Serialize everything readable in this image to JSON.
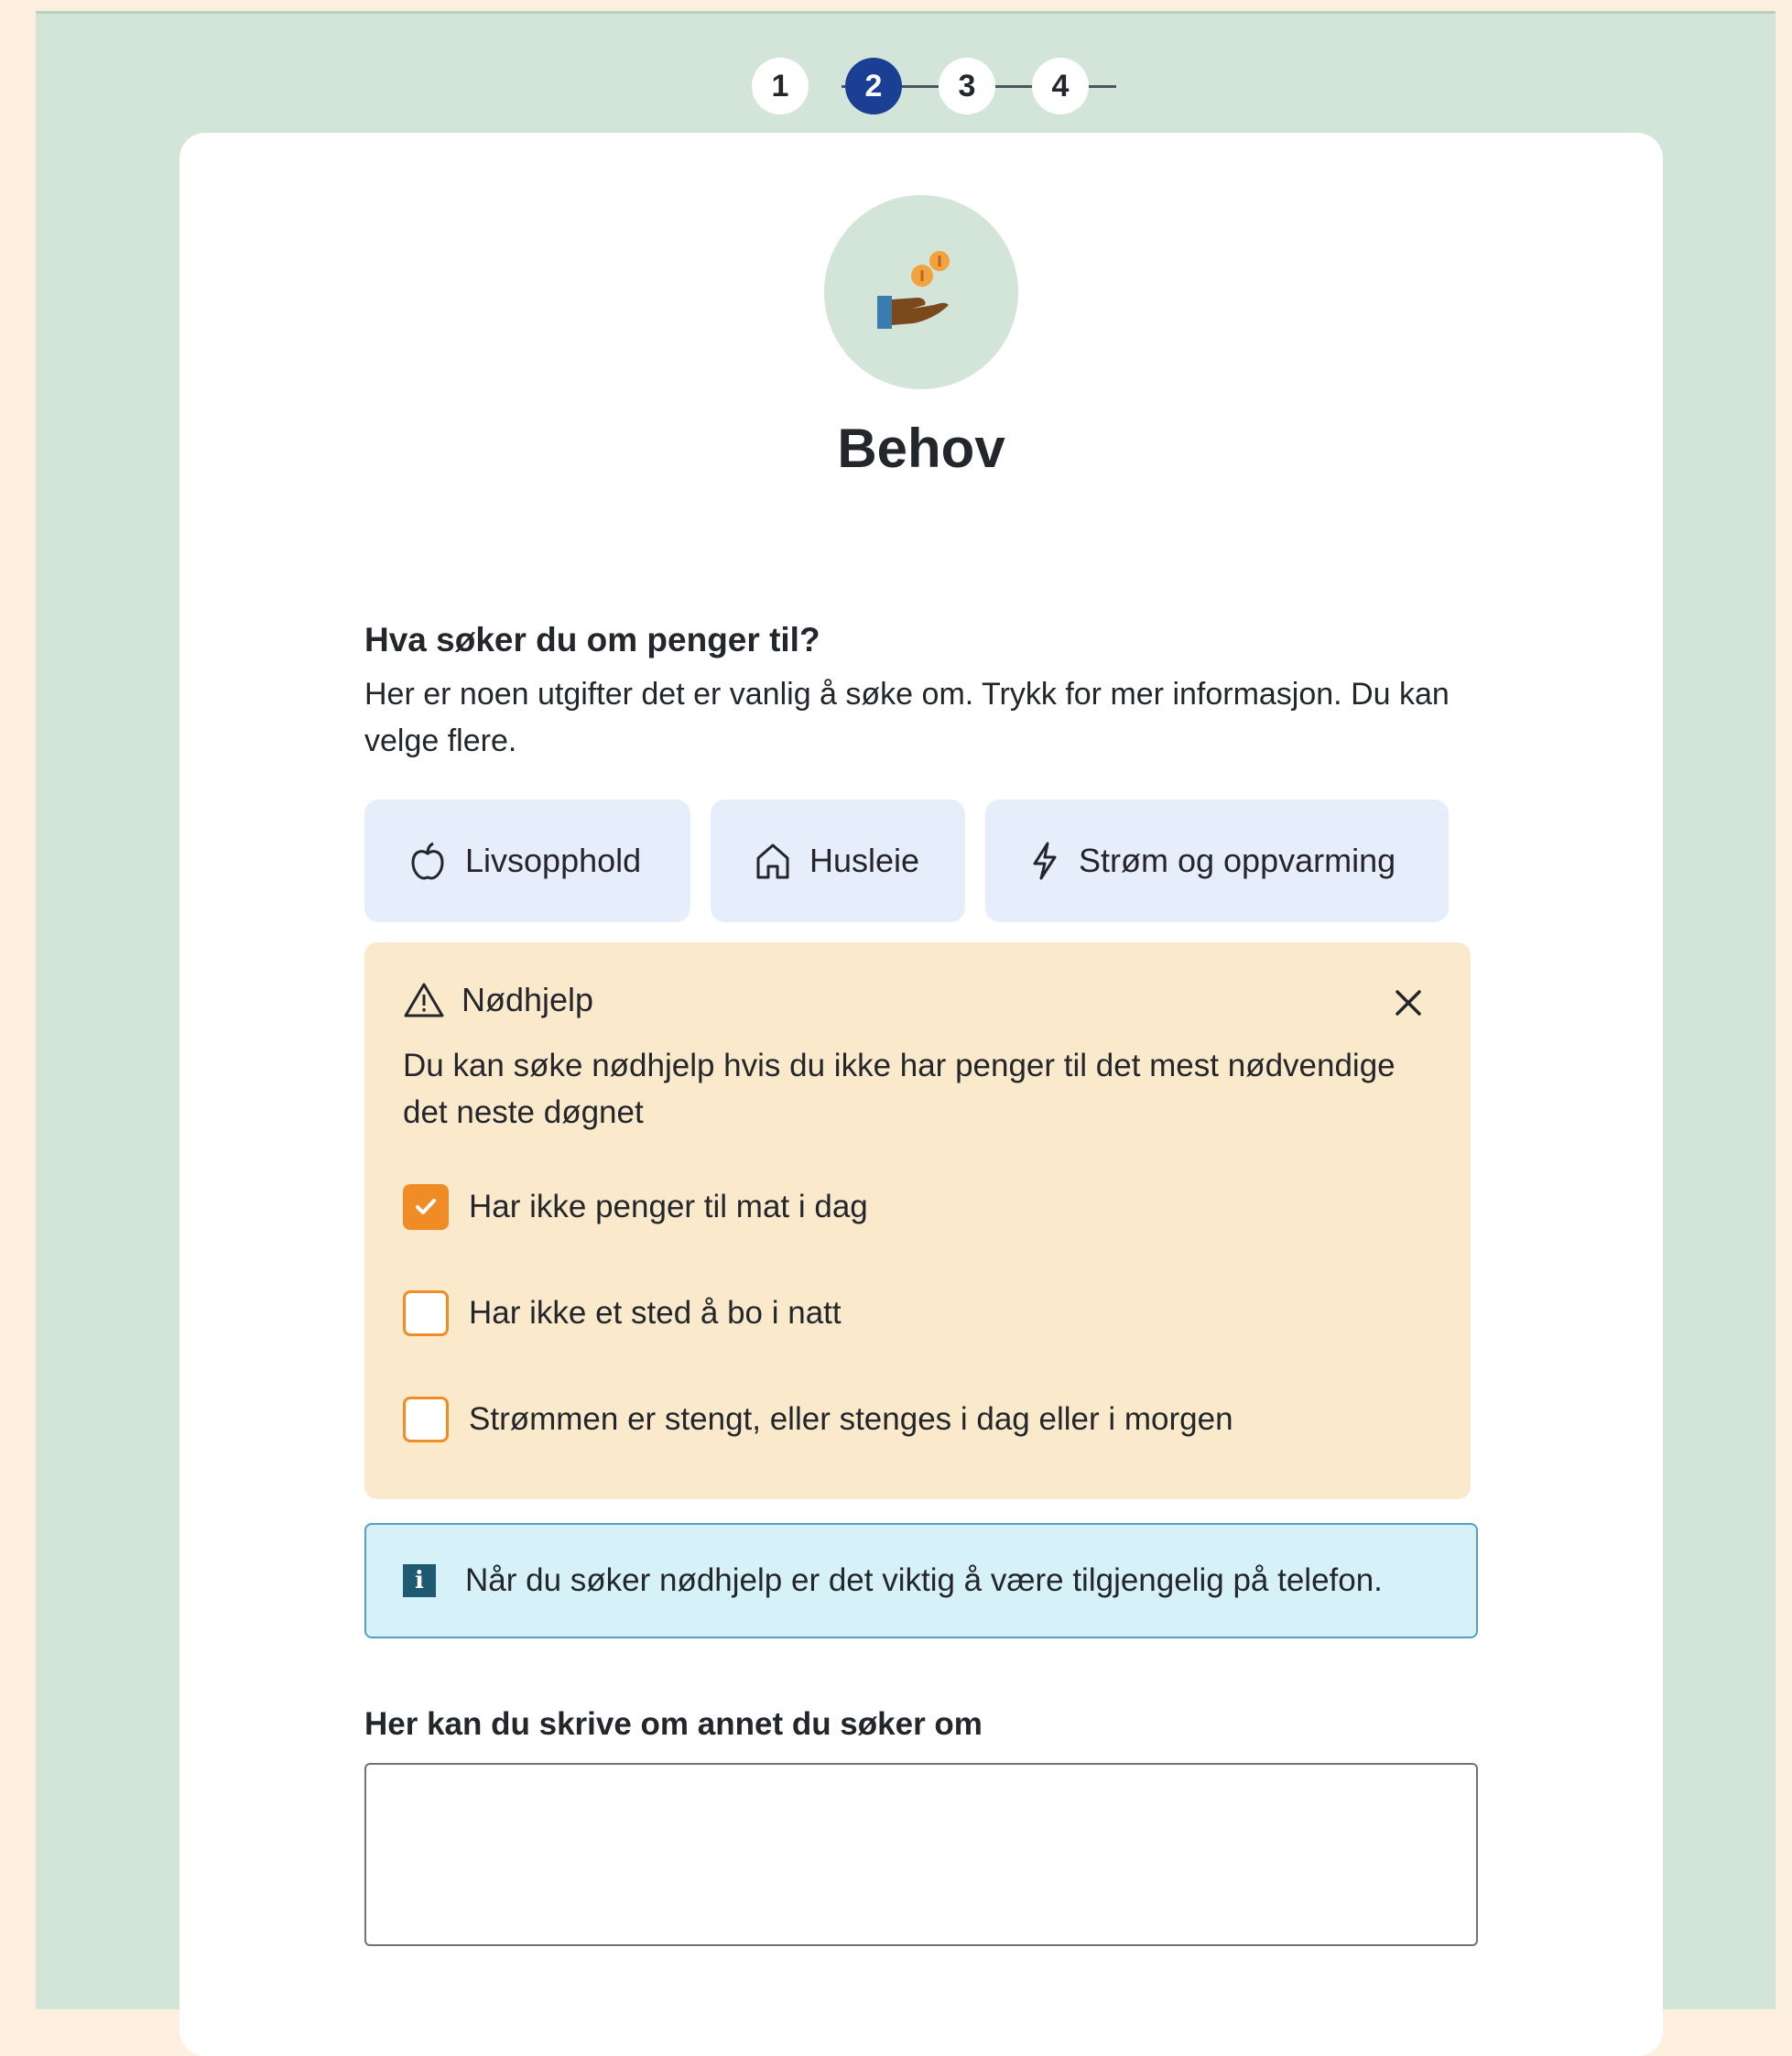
{
  "stepper": {
    "steps": [
      "1",
      "2",
      "3",
      "4"
    ],
    "current": "2"
  },
  "header": {
    "title": "Behov",
    "avatar_icon": "hand-coins-icon"
  },
  "question": {
    "title": "Hva søker du om penger til?",
    "description": "Her er noen utgifter det er vanlig å søke om. Trykk for mer informasjon. Du kan velge flere."
  },
  "chips": [
    {
      "label": "Livsopphold",
      "icon": "apple-icon"
    },
    {
      "label": "Husleie",
      "icon": "house-icon"
    },
    {
      "label": "Strøm og oppvarming",
      "icon": "lightning-icon"
    }
  ],
  "emergency": {
    "title": "Nødhjelp",
    "description": "Du kan søke nødhjelp hvis du ikke har penger til det mest nødvendige det neste døgnet",
    "options": [
      {
        "label": "Har ikke penger til mat i dag",
        "checked": true
      },
      {
        "label": "Har ikke et sted å bo i natt",
        "checked": false
      },
      {
        "label": "Strømmen er stengt, eller stenges i dag eller i morgen",
        "checked": false
      }
    ]
  },
  "info": {
    "text": "Når du søker nødhjelp er det viktig å være tilgjengelig på telefon.",
    "icon_glyph": "i"
  },
  "other": {
    "label": "Her kan du skrive om annet du søker om",
    "value": ""
  },
  "colors": {
    "background": "#fdf0de",
    "page": "#d3e4d8",
    "active_step": "#1b3f94",
    "chip": "#e6eefb",
    "alert": "#fbe9cc",
    "checkbox": "#f08c25",
    "info": "#d6f2f8"
  }
}
